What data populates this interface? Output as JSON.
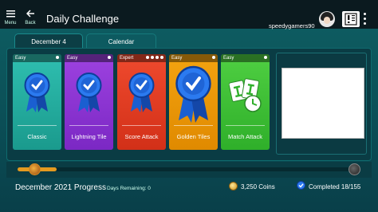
{
  "topbar": {
    "menu_label": "Menu",
    "back_label": "Back",
    "title": "Daily Challenge",
    "username": "speedygamers90"
  },
  "tabs": [
    {
      "label": "December 4",
      "active": true
    },
    {
      "label": "Calendar",
      "active": false
    }
  ],
  "challenges": [
    {
      "difficulty": "Easy",
      "name": "Classic",
      "color": "#1fa898",
      "icon": "blue-ribbon-icon",
      "dots": 1
    },
    {
      "difficulty": "Easy",
      "name": "Lightning Tile",
      "color": "#8a35d2",
      "icon": "blue-ribbon-icon",
      "dots": 1
    },
    {
      "difficulty": "Expert",
      "name": "Score Attack",
      "color": "#e03c22",
      "icon": "blue-ribbon-icon",
      "dots": 4
    },
    {
      "difficulty": "Easy",
      "name": "Golden Tiles",
      "color": "#ef9a08",
      "icon": "large-blue-ribbon-icon",
      "dots": 1
    },
    {
      "difficulty": "Easy",
      "name": "Match Attack",
      "color": "#3dbf36",
      "icon": "tiles-clock-icon",
      "dots": 1
    }
  ],
  "progress": {
    "title": "December 2021 Progress",
    "days_remaining": "Days Remaining: 0",
    "coins": "3,250 Coins",
    "completed": "Completed 18/155",
    "fraction": 0.116
  }
}
